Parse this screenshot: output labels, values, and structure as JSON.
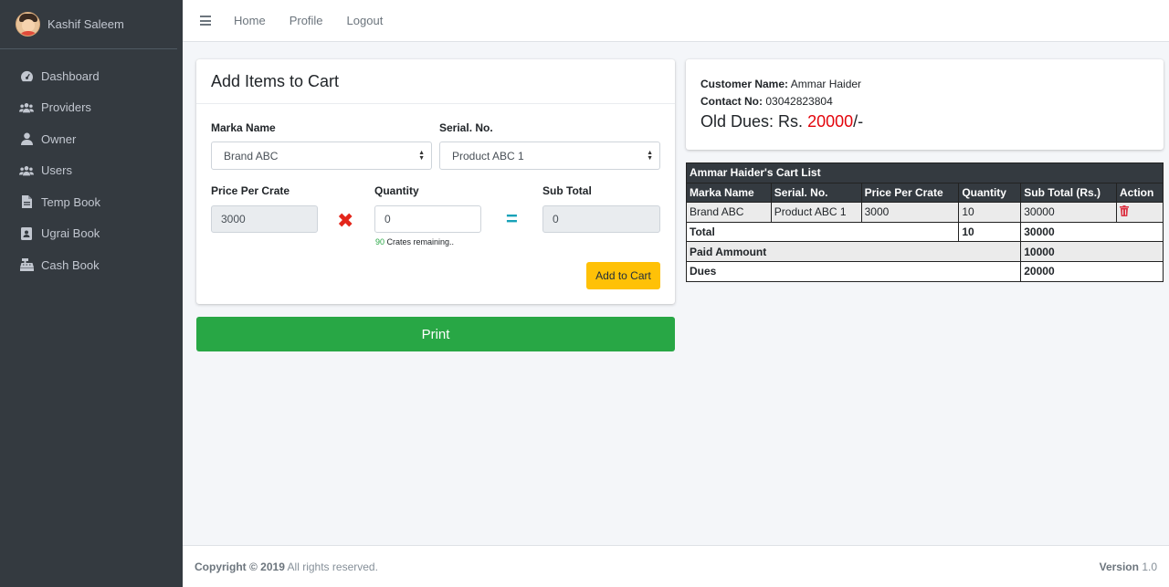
{
  "user": {
    "name": "Kashif Saleem"
  },
  "sidebar": {
    "items": [
      {
        "label": "Dashboard",
        "icon": "dashboard-icon"
      },
      {
        "label": "Providers",
        "icon": "users-icon"
      },
      {
        "label": "Owner",
        "icon": "user-icon"
      },
      {
        "label": "Users",
        "icon": "users-icon"
      },
      {
        "label": "Temp Book",
        "icon": "file-icon"
      },
      {
        "label": "Ugrai Book",
        "icon": "contact-book-icon"
      },
      {
        "label": "Cash Book",
        "icon": "cash-register-icon"
      }
    ]
  },
  "topnav": {
    "home": "Home",
    "profile": "Profile",
    "logout": "Logout"
  },
  "add_card": {
    "title": "Add Items to Cart",
    "marka_label": "Marka Name",
    "marka_value": "Brand ABC",
    "serial_label": "Serial. No.",
    "serial_value": "Product ABC 1",
    "price_label": "Price Per Crate",
    "price_value": "3000",
    "quantity_label": "Quantity",
    "quantity_value": "0",
    "subtotal_label": "Sub Total",
    "subtotal_value": "0",
    "remaining_count": "90",
    "remaining_text": "Crates remaining..",
    "add_button": "Add to Cart",
    "times_symbol": "✖",
    "equals_symbol": "="
  },
  "print_button": "Print",
  "customer": {
    "name_label": "Customer Name:",
    "name": "Ammar Haider",
    "contact_label": "Contact No:",
    "contact": "03042823804",
    "dues_prefix": "Old Dues: Rs.",
    "dues_amount": "20000",
    "dues_suffix": "/-"
  },
  "cart": {
    "caption": "Ammar Haider's Cart List",
    "headers": [
      "Marka Name",
      "Serial. No.",
      "Price Per Crate",
      "Quantity",
      "Sub Total (Rs.)",
      "Action"
    ],
    "rows": [
      {
        "marka": "Brand ABC",
        "serial": "Product ABC 1",
        "price": "3000",
        "quantity": "10",
        "subtotal": "30000"
      }
    ],
    "total_label": "Total",
    "total_quantity": "10",
    "total_amount": "30000",
    "paid_label": "Paid Ammount",
    "paid_amount": "10000",
    "dues_label": "Dues",
    "dues_amount": "20000"
  },
  "footer": {
    "copyright": "Copyright © 2019",
    "rights": "All rights reserved.",
    "version_label": "Version",
    "version": "1.0"
  },
  "colors": {
    "sidebar_bg": "#343a40",
    "print_button": "#28a745",
    "add_button": "#ffc107",
    "dues_red": "#e3050c",
    "delete_red": "#dc3545"
  }
}
